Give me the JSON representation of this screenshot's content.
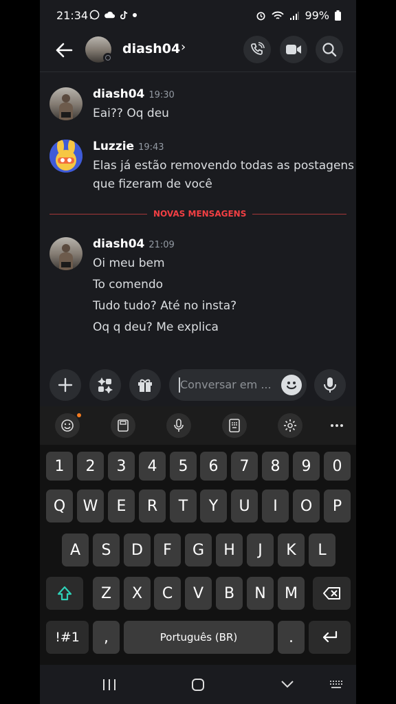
{
  "status_bar": {
    "time": "21:34",
    "battery": "99%"
  },
  "header": {
    "username": "diash04",
    "chevron": "›"
  },
  "messages": [
    {
      "author": "diash04",
      "time": "19:30",
      "avatar": "photo",
      "lines": [
        "Eai?? Oq deu"
      ]
    },
    {
      "author": "Luzzie",
      "time": "19:43",
      "avatar": "bunny",
      "lines": [
        "Elas já estão removendo todas as postagens",
        "que fizeram de você"
      ]
    },
    {
      "author": "diash04",
      "time": "21:09",
      "avatar": "photo",
      "lines": [
        "Oi meu bem",
        "To comendo",
        "Tudo tudo? Até no insta?",
        "Oq q deu? Me explica"
      ]
    }
  ],
  "divider_label": "NOVAS MENSAGENS",
  "composer": {
    "placeholder": "Conversar em ..."
  },
  "keyboard": {
    "row_numbers": [
      "1",
      "2",
      "3",
      "4",
      "5",
      "6",
      "7",
      "8",
      "9",
      "0"
    ],
    "row_1": [
      "Q",
      "W",
      "E",
      "R",
      "T",
      "Y",
      "U",
      "I",
      "O",
      "P"
    ],
    "row_2": [
      "A",
      "S",
      "D",
      "F",
      "G",
      "H",
      "J",
      "K",
      "L"
    ],
    "row_3": [
      "Z",
      "X",
      "C",
      "V",
      "B",
      "N",
      "M"
    ],
    "symbols_key": "!#1",
    "comma_key": ",",
    "space_label": "Português (BR)",
    "period_key": "."
  },
  "colors": {
    "background": "#1a1b1f",
    "divider_red": "#f23f43",
    "bubble_button": "#2b2d31",
    "key": "#3b3b3b"
  }
}
